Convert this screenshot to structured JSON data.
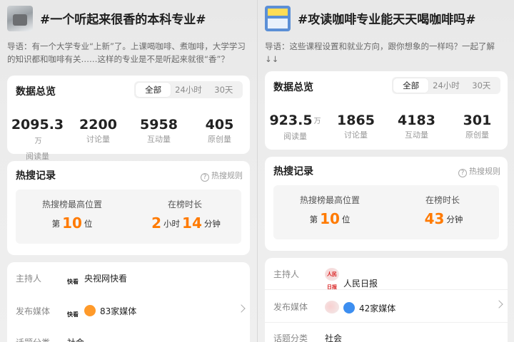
{
  "left": {
    "title": "#一个听起来很香的本科专业#",
    "intro": "导语：有一个大学专业“上新”了。上课喝咖啡、煮咖啡，大学学习的知识都和咖啡有关……这样的专业是不是听起来就很“香”？",
    "overview": {
      "title": "数据总览",
      "tabs": [
        "全部",
        "24小时",
        "30天"
      ],
      "active_tab": "全部",
      "stats": [
        {
          "value": "2095.3",
          "unit": "万",
          "label": "阅读量"
        },
        {
          "value": "2200",
          "unit": "",
          "label": "讨论量"
        },
        {
          "value": "5958",
          "unit": "",
          "label": "互动量"
        },
        {
          "value": "405",
          "unit": "",
          "label": "原创量"
        }
      ]
    },
    "hot": {
      "title": "热搜记录",
      "rule": "热搜规则",
      "rank_label": "热搜榜最高位置",
      "rank_pre": "第",
      "rank_num": "10",
      "rank_post": "位",
      "duration_label": "在榜时长",
      "hours": "2",
      "hours_unit": "小时",
      "minutes": "14",
      "minutes_unit": "分钟"
    },
    "info": {
      "host_label": "主持人",
      "host_logo": "快看",
      "host": "央视网快看",
      "media_label": "发布媒体",
      "media_logo": "快看",
      "media": "83家媒体",
      "category_label": "话题分类",
      "category": "社会"
    }
  },
  "right": {
    "title": "#攻读咖啡专业能天天喝咖啡吗#",
    "intro": "导语：这些课程设置和就业方向，跟你想象的一样吗？一起了解↓↓",
    "overview": {
      "title": "数据总览",
      "tabs": [
        "全部",
        "24小时",
        "30天"
      ],
      "active_tab": "全部",
      "stats": [
        {
          "value": "923.5",
          "unit": "万",
          "label": "阅读量"
        },
        {
          "value": "1865",
          "unit": "",
          "label": "讨论量"
        },
        {
          "value": "4183",
          "unit": "",
          "label": "互动量"
        },
        {
          "value": "301",
          "unit": "",
          "label": "原创量"
        }
      ]
    },
    "hot": {
      "title": "热搜记录",
      "rule": "热搜规则",
      "rank_label": "热搜榜最高位置",
      "rank_pre": "第",
      "rank_num": "10",
      "rank_post": "位",
      "duration_label": "在榜时长",
      "minutes": "43",
      "minutes_unit": "分钟"
    },
    "info": {
      "host_label": "主持人",
      "host_logo": "人民日报",
      "host": "人民日报",
      "media_label": "发布媒体",
      "media": "42家媒体",
      "category_label": "话题分类",
      "category": "社会"
    }
  },
  "colors": {
    "accent": "#ff7a00",
    "card": "#ffffff",
    "background": "#eeeeee"
  }
}
